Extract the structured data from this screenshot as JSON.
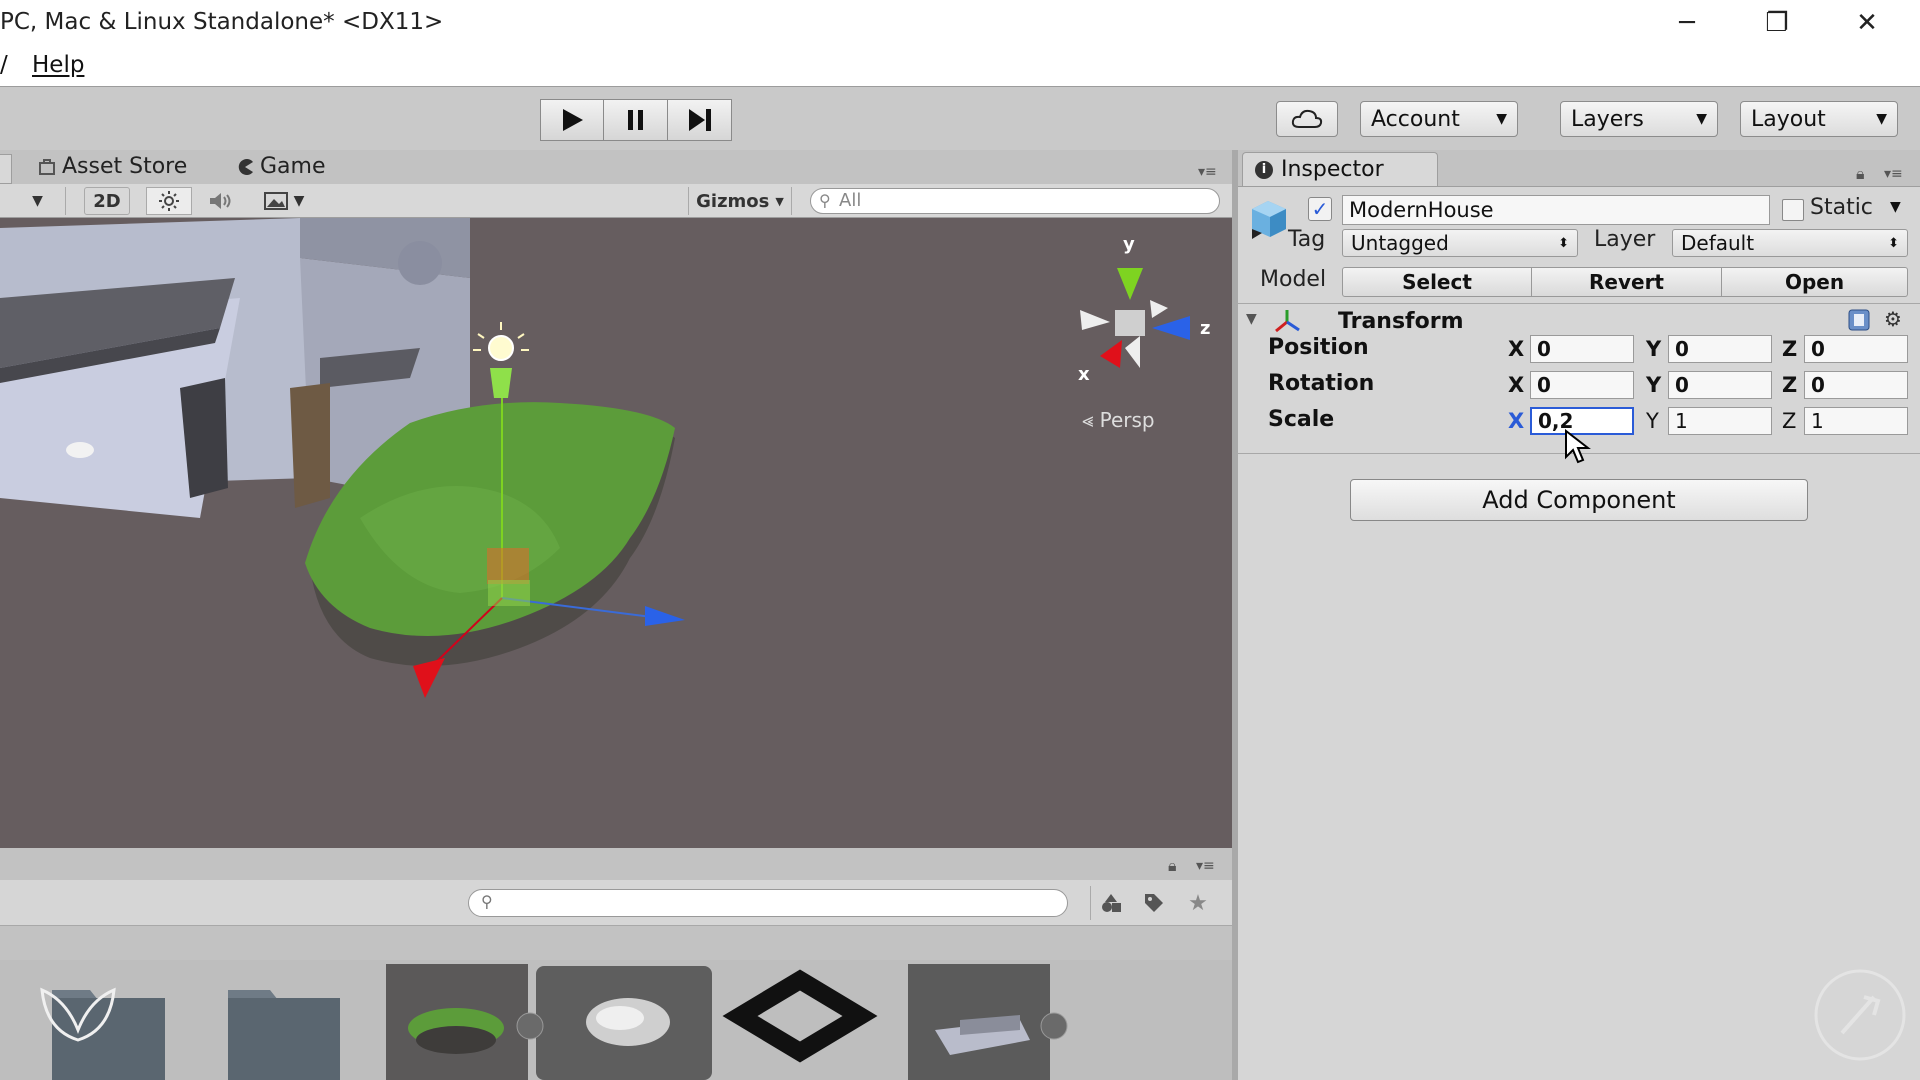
{
  "window": {
    "title": "PC, Mac & Linux Standalone* <DX11>",
    "minimize": "─",
    "restore": "❐",
    "close": "✕"
  },
  "menu": {
    "edge": "/",
    "help": "Help"
  },
  "toolbar": {
    "account": "Account",
    "layers": "Layers",
    "layout": "Layout"
  },
  "scene": {
    "tabs": {
      "asset_store": "Asset Store",
      "game": "Game"
    },
    "mode_2d": "2D",
    "gizmos": "Gizmos",
    "search_placeholder": "All",
    "persp": "Persp",
    "gizmo_axes": {
      "x": "x",
      "y": "y",
      "z": "z"
    }
  },
  "inspector": {
    "tab_label": "Inspector",
    "object_name": "ModernHouse",
    "static_label": "Static",
    "tag_label": "Tag",
    "tag_value": "Untagged",
    "layer_label": "Layer",
    "layer_value": "Default",
    "model_label": "Model",
    "model_buttons": {
      "select": "Select",
      "revert": "Revert",
      "open": "Open"
    },
    "transform": {
      "title": "Transform",
      "position": {
        "label": "Position",
        "x": "0",
        "y": "0",
        "z": "0"
      },
      "rotation": {
        "label": "Rotation",
        "x": "0",
        "y": "0",
        "z": "0"
      },
      "scale": {
        "label": "Scale",
        "x": "0,2",
        "y": "1",
        "z": "1"
      }
    },
    "add_component": "Add Component"
  },
  "colors": {
    "viewport_bg": "#665d5f",
    "panel_bg": "#c2c2c2",
    "grass": "#5a9a3a",
    "focus_blue": "#2a5bd7"
  }
}
